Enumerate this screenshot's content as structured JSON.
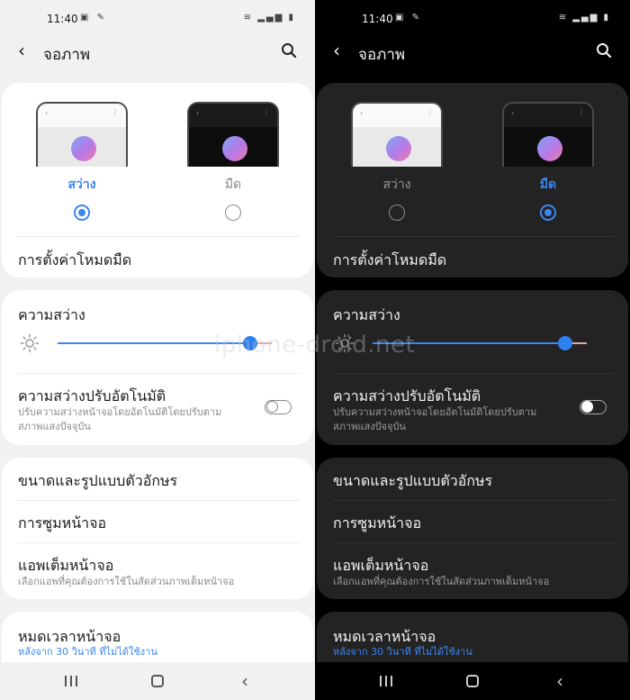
{
  "status_bar": {
    "time": "11:40",
    "icons_left": "▣ ✎",
    "icons_right": "≋ ▂▄▆ ▮"
  },
  "app_bar": {
    "title": "จอภาพ"
  },
  "theme": {
    "light_label": "สว่าง",
    "dark_label": "มืด"
  },
  "dark_mode_settings": "การตั้งค่าโหมดมืด",
  "brightness": {
    "title": "ความสว่าง",
    "level": 0.9,
    "adaptive_title": "ความสว่างปรับอัตโนมัติ",
    "adaptive_desc_line1": "ปรับความสว่างหน้าจอโดยอัตโนมัติโดยปรับตาม",
    "adaptive_desc_line2": "สภาพแสงปัจจุบัน",
    "adaptive_enabled": false
  },
  "font": {
    "title": "ขนาดและรูปแบบตัวอักษร"
  },
  "zoom": {
    "title": "การซูมหน้าจอ"
  },
  "fullscreen_apps": {
    "title": "แอพเต็มหน้าจอ",
    "desc": "เลือกแอพที่คุณต้องการใช้ในสัดส่วนภาพเต็มหน้าจอ"
  },
  "screen_timeout": {
    "title": "หมดเวลาหน้าจอ",
    "desc": "หลังจาก 30 วินาที ที่ไม่ได้ใช้งาน"
  },
  "panels": [
    {
      "mode": "light",
      "selected_theme": "light"
    },
    {
      "mode": "dark",
      "selected_theme": "dark"
    }
  ],
  "watermark": "iphone-droid.net",
  "colors": {
    "accent": "#3b86f2",
    "light_bg": "#f1f1f1",
    "dark_bg": "#000000",
    "light_card": "#ffffff",
    "dark_card": "#232323"
  }
}
